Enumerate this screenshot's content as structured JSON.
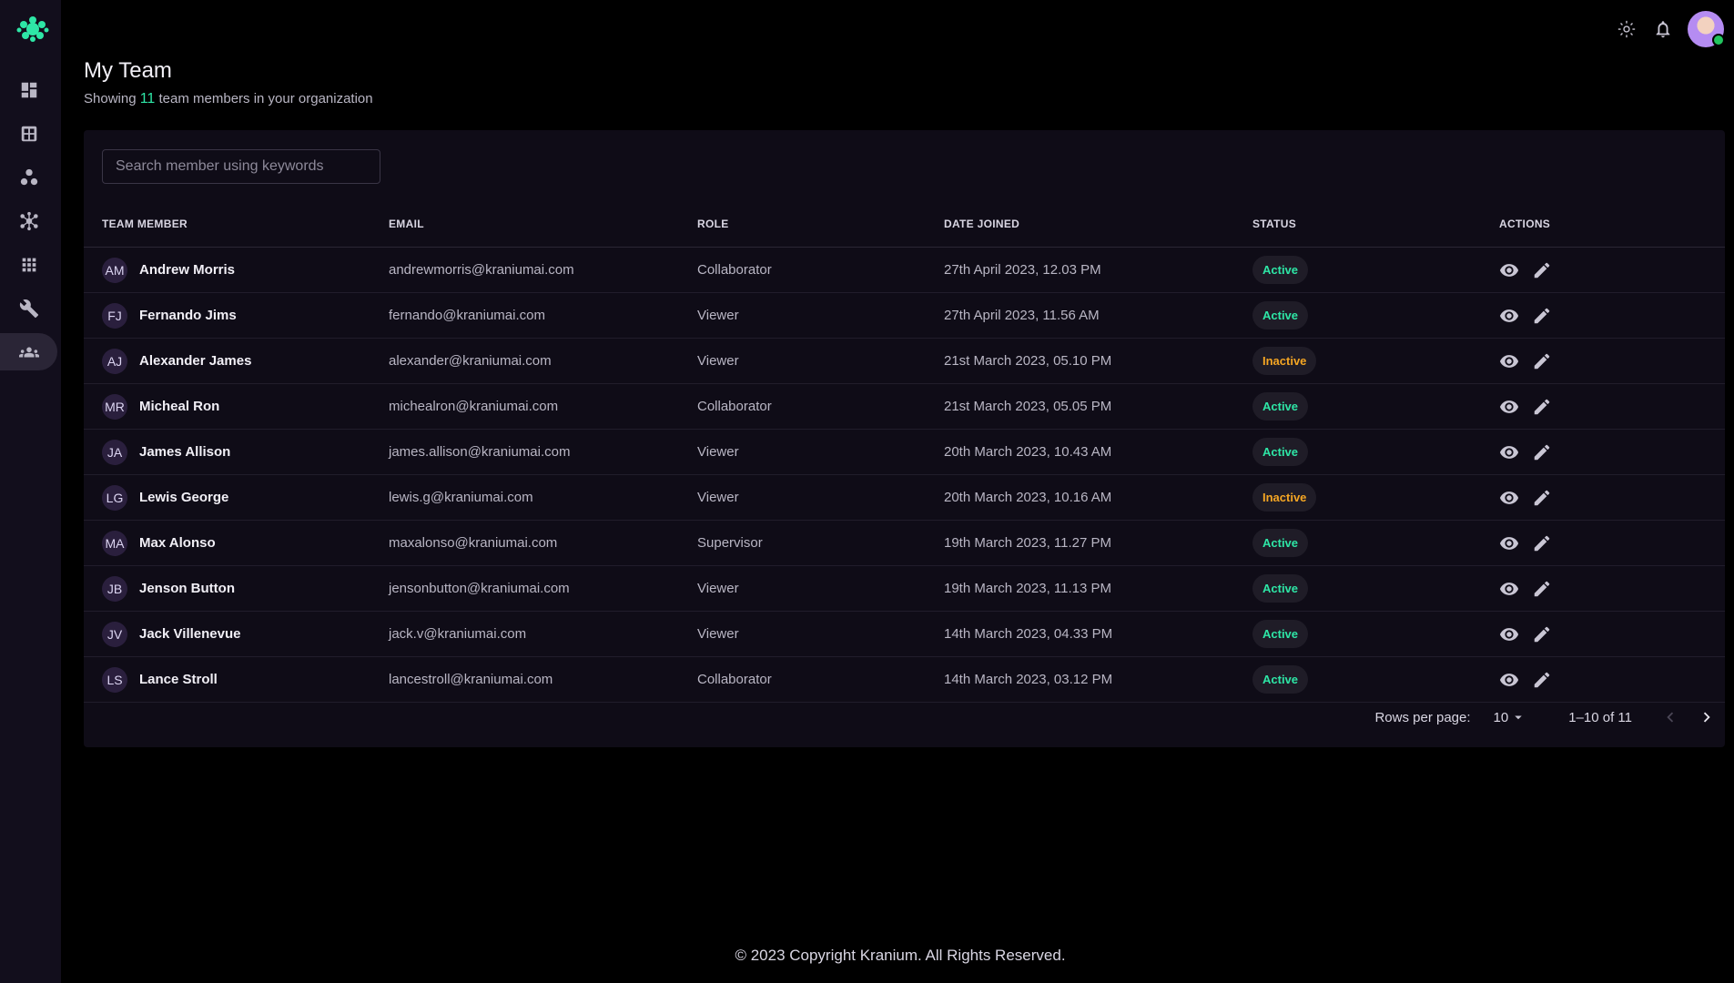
{
  "page": {
    "title": "My Team",
    "subtitle_prefix": "Showing",
    "member_count": "11",
    "subtitle_suffix": "team members in your organization"
  },
  "search": {
    "placeholder": "Search member using keywords"
  },
  "table": {
    "columns": [
      "TEAM MEMBER",
      "EMAIL",
      "ROLE",
      "DATE JOINED",
      "STATUS",
      "ACTIONS"
    ],
    "rows": [
      {
        "initials": "AM",
        "name": "Andrew Morris",
        "email": "andrewmorris@kraniumai.com",
        "role": "Collaborator",
        "date": "27th April 2023, 12.03 PM",
        "status": "Active"
      },
      {
        "initials": "FJ",
        "name": "Fernando Jims",
        "email": "fernando@kraniumai.com",
        "role": "Viewer",
        "date": "27th April 2023, 11.56 AM",
        "status": "Active"
      },
      {
        "initials": "AJ",
        "name": "Alexander James",
        "email": "alexander@kraniumai.com",
        "role": "Viewer",
        "date": "21st March 2023, 05.10 PM",
        "status": "Inactive"
      },
      {
        "initials": "MR",
        "name": "Micheal Ron",
        "email": "michealron@kraniumai.com",
        "role": "Collaborator",
        "date": "21st March 2023, 05.05 PM",
        "status": "Active"
      },
      {
        "initials": "JA",
        "name": "James Allison",
        "email": "james.allison@kraniumai.com",
        "role": "Viewer",
        "date": "20th March 2023, 10.43 AM",
        "status": "Active"
      },
      {
        "initials": "LG",
        "name": "Lewis George",
        "email": "lewis.g@kraniumai.com",
        "role": "Viewer",
        "date": "20th March 2023, 10.16 AM",
        "status": "Inactive"
      },
      {
        "initials": "MA",
        "name": "Max Alonso",
        "email": "maxalonso@kraniumai.com",
        "role": "Supervisor",
        "date": "19th March 2023, 11.27 PM",
        "status": "Active"
      },
      {
        "initials": "JB",
        "name": "Jenson Button",
        "email": "jensonbutton@kraniumai.com",
        "role": "Viewer",
        "date": "19th March 2023, 11.13 PM",
        "status": "Active"
      },
      {
        "initials": "JV",
        "name": "Jack Villenevue",
        "email": "jack.v@kraniumai.com",
        "role": "Viewer",
        "date": "14th March 2023, 04.33 PM",
        "status": "Active"
      },
      {
        "initials": "LS",
        "name": "Lance Stroll",
        "email": "lancestroll@kraniumai.com",
        "role": "Collaborator",
        "date": "14th March 2023, 03.12 PM",
        "status": "Active"
      }
    ]
  },
  "pagination": {
    "rows_per_page_label": "Rows per page:",
    "rows_per_page": "10",
    "range": "1–10 of 11"
  },
  "footer": {
    "text": "© 2023 Copyright Kranium. All Rights Reserved."
  },
  "sidebar": {
    "items": [
      "dashboard-icon",
      "grid-icon",
      "nodes-icon",
      "network-icon",
      "apps-icon",
      "wrench-icon",
      "team-icon"
    ],
    "active": "team-icon"
  },
  "colors": {
    "accent": "#2ee6a6",
    "inactive": "#f5a623",
    "card": "#0f0c17",
    "sidebar": "#120e1c"
  }
}
